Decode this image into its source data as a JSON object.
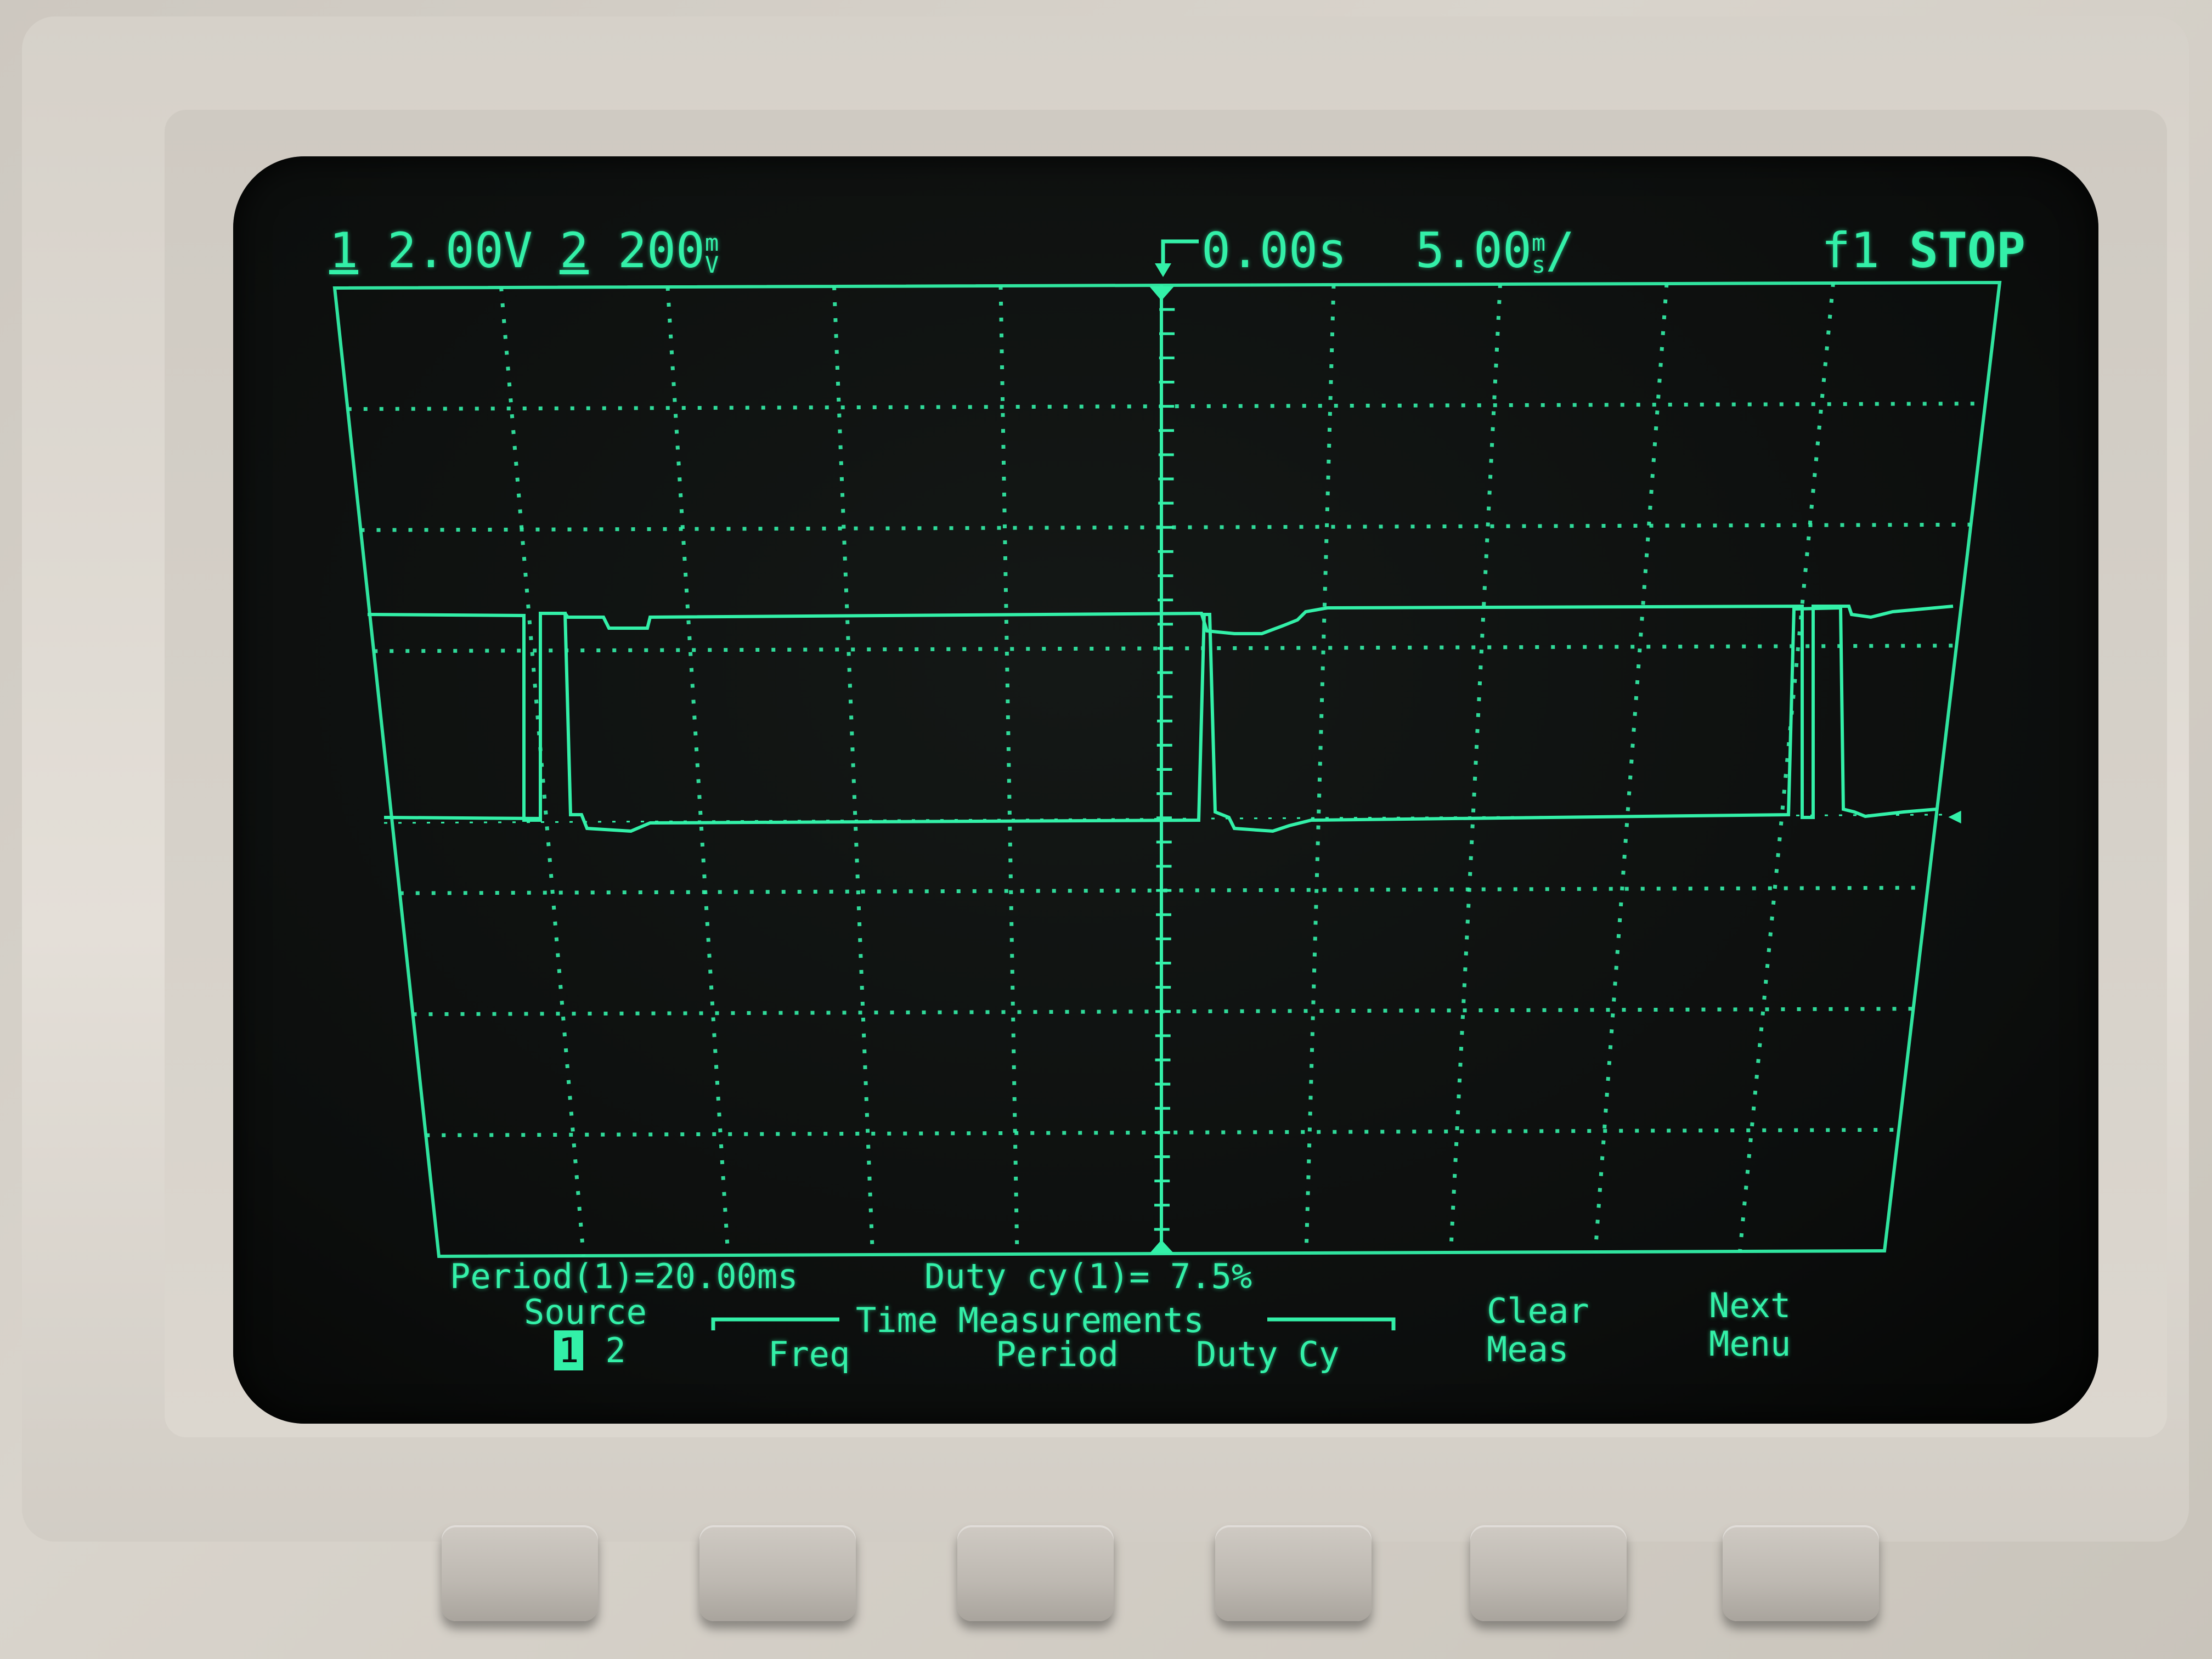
{
  "status": {
    "ch1_num": "1",
    "ch1_scale": "2.00V",
    "ch2_num": "2",
    "ch2_scale": "200",
    "ch2_unit_top": "m",
    "ch2_unit_bottom": "V",
    "delay": "0.00s",
    "timebase": "5.00",
    "timebase_unit_top": "m",
    "timebase_unit_bottom": "s",
    "timebase_slash": "/",
    "trigger": "f1",
    "run_state": "STOP"
  },
  "measurements": {
    "period": "Period(1)=20.00ms",
    "duty": "Duty cy(1)= 7.5%"
  },
  "softkeys": {
    "source_label": "Source",
    "source_1": "1",
    "source_2": "2",
    "group_label": "Time Measurements",
    "freq": "Freq",
    "period": "Period",
    "duty": "Duty Cy",
    "clear_line1": "Clear",
    "clear_line2": "Meas",
    "next_line1": "Next",
    "next_line2": "Menu"
  },
  "colors": {
    "trace": "#33f0a8",
    "screen": "#0c0e0d",
    "bezel": "#d9d4cc"
  }
}
